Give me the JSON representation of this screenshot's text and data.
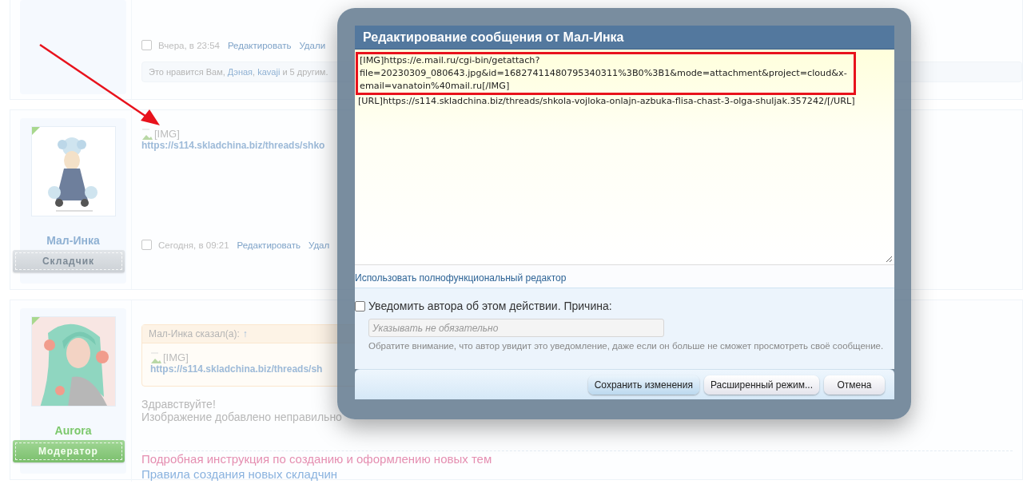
{
  "posts": [
    {
      "footer": {
        "checked": false,
        "date": "Вчера, в 23:54",
        "actions": [
          "Редактировать",
          "Удали"
        ]
      },
      "likes": [
        {
          "text": "Это нравится Вам, ",
          "link": false
        },
        {
          "text": "Дэная",
          "link": true
        },
        {
          "text": ", ",
          "link": false
        },
        {
          "text": "kavaji",
          "link": true
        },
        {
          "text": " и 5 другим.",
          "link": false
        }
      ]
    },
    {
      "author": {
        "name": "Мал-Инка",
        "role": "Складчик",
        "color": "#8fb1d3"
      },
      "body": {
        "image_alt": "[IMG]",
        "link": "https://s114.skladchina.biz/threads/shko"
      },
      "footer": {
        "checked": false,
        "date": "Сегодня, в 09:21",
        "actions": [
          "Редактировать",
          "Удал"
        ]
      }
    },
    {
      "author": {
        "name": "Aurora",
        "role": "Модератор",
        "color": "#7cc86c"
      },
      "quote": {
        "attribution": "Мал-Инка сказал(а):",
        "jump": "↑",
        "image_alt": "[IMG]",
        "link": "https://s114.skladchina.biz/threads/sh"
      },
      "text": [
        "Здравствуйте!",
        "Изображение добавлено неправильно"
      ],
      "signature": [
        {
          "text": "Подробная инструкция по созданию и оформлению новых тем",
          "color": "#e58fb1"
        },
        {
          "text": "Правила создания новых складчин",
          "color": "#8bb3df"
        }
      ]
    }
  ],
  "dialog": {
    "title": "Редактирование сообщения от Мал-Инка",
    "editor": {
      "highlighted": "[IMG]https://e.mail.ru/cgi-bin/getattach?file=20230309_080643.jpg&id=16827411480795340311%3B0%3B1&mode=attachment&project=cloud&x-email=vanatoin%40mail.ru[/IMG]",
      "text": "[URL]https://s114.skladchina.biz/threads/shkola-vojloka-onlajn-azbuka-flisa-chast-3-olga-shuljak.357242/[/URL]"
    },
    "full_editor_link": "Использовать полнофункциональный редактор",
    "notify": {
      "checked": false,
      "label": "Уведомить автора об этом действии. Причина:",
      "placeholder": "Указывать не обязательно",
      "hint": "Обратите внимание, что автор увидит это уведомление, даже если он больше не сможет просмотреть своё сообщение."
    },
    "buttons": [
      {
        "label": "Сохранить изменения",
        "primary": true
      },
      {
        "label": "Расширенный режим...",
        "primary": false
      },
      {
        "label": "Отмена",
        "primary": false
      }
    ]
  }
}
